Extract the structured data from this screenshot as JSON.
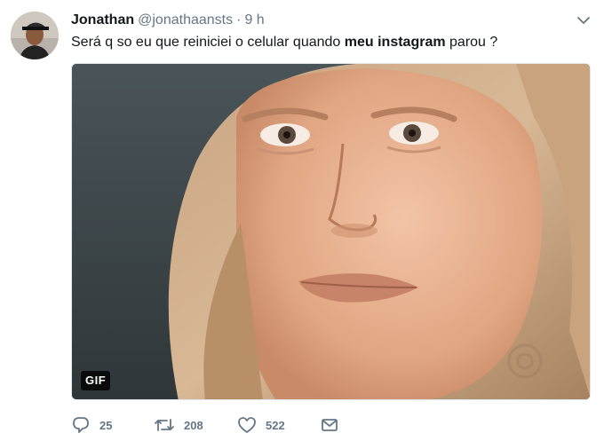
{
  "tweet": {
    "author_name": "Jonathan",
    "handle": "@jonathaansts",
    "separator": "·",
    "time": "9 h",
    "text_before": "Será q so eu que reiniciei o celular quando ",
    "text_bold": "meu instagram",
    "text_after": " parou ?"
  },
  "media": {
    "badge": "GIF"
  },
  "actions": {
    "reply_count": "25",
    "retweet_count": "208",
    "like_count": "522"
  },
  "icons": {
    "caret": "chevron-down-icon",
    "reply": "reply-icon",
    "retweet": "retweet-icon",
    "like": "heart-icon",
    "dm": "envelope-icon"
  },
  "colors": {
    "text": "#14171a",
    "secondary": "#657786",
    "badge_bg": "#000000"
  }
}
